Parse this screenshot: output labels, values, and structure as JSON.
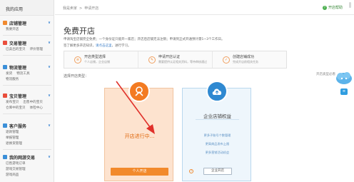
{
  "sidebar": {
    "title": "我的应用",
    "groups": [
      {
        "label": "店铺管理",
        "color": "#f08a30",
        "subs": [
          "我要开店"
        ]
      },
      {
        "label": "交易管理",
        "color": "#e94e3c",
        "subs": [
          "已卖出的宝贝",
          "评价管理"
        ]
      },
      {
        "label": "物流管理",
        "color": "#3b8fd8",
        "subs": [
          "发货",
          "物流工具",
          "物流服务"
        ]
      },
      {
        "label": "宝贝管理",
        "color": "#e94e3c",
        "subs": [
          "发布宝贝",
          "出售中的宝贝",
          "仓库中的宝贝",
          "体检中心"
        ]
      },
      {
        "label": "客户服务",
        "color": "#3b8fd8",
        "subs": [
          "退款管理",
          "举报管理",
          "退换货管理"
        ]
      },
      {
        "label": "我的网游交易",
        "color": "#3b8fd8",
        "subs": [
          "已售游戏订单",
          "游戏交易管理",
          "游戏商品"
        ]
      }
    ]
  },
  "topbar": {
    "crumb1": "我是卖家",
    "crumb_sep": ">",
    "crumb2": "申请开店",
    "help": "开店帮助",
    "help_icon": "?"
  },
  "page": {
    "title": "免费开店",
    "info1": "申请淘宝店铺完全免费；一个身份证只能开一家店；开店后店铺无法注销；申请到正式开通预计需1~3个工作日。",
    "info2_prefix": "签了解更多开店知识，",
    "info2_link": "请点击这里",
    "info2_suffix": "，进行学习。",
    "type_label": "选择开店类型：",
    "type_help": "开店类型必看"
  },
  "steps": [
    {
      "icon": "≡",
      "title": "开店类型选择",
      "desc": "个人店铺，企业店铺"
    },
    {
      "icon": "✎",
      "title": "申请开店认证",
      "desc": "需要提供认证相关资料，等待审核通过"
    },
    {
      "icon": "✓",
      "title": "创建店铺成功",
      "desc": "完成开店前相关任务"
    }
  ],
  "personal": {
    "status": "开店进行中...",
    "button": "个人开店",
    "accent": "#f37b22"
  },
  "enterprise": {
    "title": "企业店铺权益",
    "benefits": [
      "更多子账号个数管理",
      "更高商品发布上限",
      "更多营销活动机会"
    ],
    "question": "?",
    "button": "企业开店",
    "accent": "#2f89d1"
  },
  "widgets": {
    "chat": "≡"
  }
}
